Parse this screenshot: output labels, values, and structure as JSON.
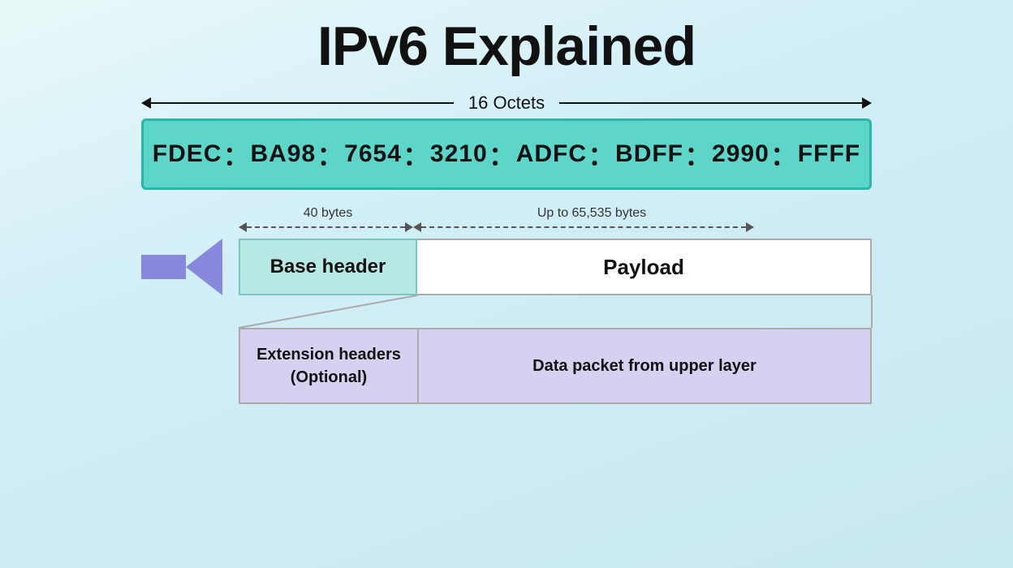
{
  "page": {
    "title": "IPv6 Explained",
    "octets_label": "16 Octets",
    "ip_segments": [
      "FDEC",
      "BA98",
      "7654",
      "3210",
      "ADFC",
      "BDFF",
      "2990",
      "FFFF"
    ],
    "bytes_40_label": "40 bytes",
    "bytes_65_label": "Up to 65,535 bytes",
    "base_header_label": "Base header",
    "payload_label": "Payload",
    "extension_headers_label": "Extension headers\n(Optional)",
    "data_packet_label": "Data packet from upper layer"
  }
}
